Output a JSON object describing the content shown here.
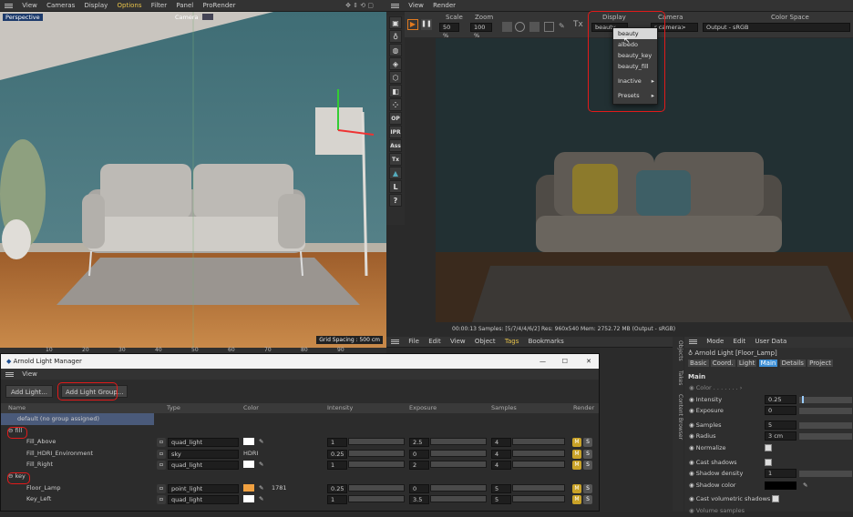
{
  "left_viewport": {
    "menu": [
      "View",
      "Cameras",
      "Display",
      "Options",
      "Filter",
      "Panel",
      "ProRender"
    ],
    "viewport_label": "Perspective",
    "camera_label": "Camera",
    "grid_spacing": "Grid Spacing : 500 cm",
    "ruler": [
      "10",
      "20",
      "30",
      "40",
      "50",
      "60",
      "70",
      "80",
      "90"
    ]
  },
  "left_icons": [
    "OP",
    "IPR",
    "Ass",
    "Tx",
    "L",
    "?"
  ],
  "render_view": {
    "menu": [
      "View",
      "Render"
    ],
    "scale_label": "Scale",
    "scale_value": "50 %",
    "zoom_label": "Zoom",
    "zoom_value": "100 %",
    "tx_label": "Tx",
    "display_label": "Display",
    "display_value": "beauty",
    "camera_label": "Camera",
    "camera_value": "r camera>",
    "colorspace_label": "Color Space",
    "colorspace_value": "Output - sRGB",
    "dropdown": [
      "beauty",
      "albedo",
      "beauty_key",
      "beauty_fill",
      "Inactive",
      "Presets"
    ],
    "status": "00:00:13  Samples: [5/7/4/4/6/2]  Res: 960x540  Mem: 2752.72 MB  (Output - sRGB)"
  },
  "object_manager": {
    "menu": [
      "File",
      "Edit",
      "View",
      "Object",
      "Tags",
      "Bookmarks"
    ],
    "side_tabs": [
      "Objects",
      "Takes",
      "Content Browser"
    ]
  },
  "attribute_manager": {
    "menu": [
      "Mode",
      "Edit",
      "User Data"
    ],
    "object": "Arnold Light [Floor_Lamp]",
    "tabs": [
      "Basic",
      "Coord.",
      "Light",
      "Main",
      "Details",
      "Project"
    ],
    "active_tab": "Main",
    "section": "Main",
    "rows": [
      {
        "label": "Color",
        "value": ""
      },
      {
        "label": "Intensity",
        "value": "0.25"
      },
      {
        "label": "Exposure",
        "value": "0"
      },
      {
        "label": "Samples",
        "value": "5"
      },
      {
        "label": "Radius",
        "value": "3 cm"
      },
      {
        "label": "Normalize",
        "value": ""
      },
      {
        "label": "Cast shadows",
        "value": ""
      },
      {
        "label": "Shadow density",
        "value": "1"
      },
      {
        "label": "Shadow color",
        "value": ""
      },
      {
        "label": "Cast volumetric shadows",
        "value": ""
      },
      {
        "label": "Volume samples",
        "value": ""
      }
    ]
  },
  "light_manager": {
    "title": "Arnold Light Manager",
    "menu": "View",
    "add_light": "Add Light...",
    "add_group": "Add Light Group...",
    "columns": [
      "Name",
      "Type",
      "Color",
      "Intensity",
      "Exposure",
      "Samples",
      "Render"
    ],
    "rows": [
      {
        "indent": 1,
        "name": "default (no group assigned)",
        "group": false,
        "selected": true,
        "type": "",
        "color": "",
        "intensity": "",
        "exposure": "",
        "samples": ""
      },
      {
        "indent": 0,
        "name": "fill",
        "group": true,
        "type": "",
        "color": "",
        "intensity": "",
        "exposure": "",
        "samples": ""
      },
      {
        "indent": 2,
        "name": "Fill_Above",
        "group": false,
        "type": "quad_light",
        "color": "#ffffff",
        "intensity": "1",
        "exposure": "2.5",
        "samples": "4"
      },
      {
        "indent": 2,
        "name": "Fill_HDRI_Environment",
        "group": false,
        "type": "sky",
        "color": "HDRI",
        "intensity": "0.25",
        "exposure": "0",
        "samples": "4"
      },
      {
        "indent": 2,
        "name": "Fill_Right",
        "group": false,
        "type": "quad_light",
        "color": "#ffffff",
        "intensity": "1",
        "exposure": "2",
        "samples": "4"
      },
      {
        "indent": 0,
        "name": "key",
        "group": true,
        "type": "",
        "color": "",
        "intensity": "",
        "exposure": "",
        "samples": ""
      },
      {
        "indent": 2,
        "name": "Floor_Lamp",
        "group": false,
        "type": "point_light",
        "color": "#f0a040",
        "colortext": "1781",
        "intensity": "0.25",
        "exposure": "0",
        "samples": "5"
      },
      {
        "indent": 2,
        "name": "Key_Left",
        "group": false,
        "type": "quad_light",
        "color": "#ffffff",
        "intensity": "1",
        "exposure": "3.5",
        "samples": "5"
      }
    ]
  },
  "colors": {
    "accent": "#3d8fd6",
    "highlight_red": "#e21a1a",
    "options_menu": "#e8c34a"
  }
}
